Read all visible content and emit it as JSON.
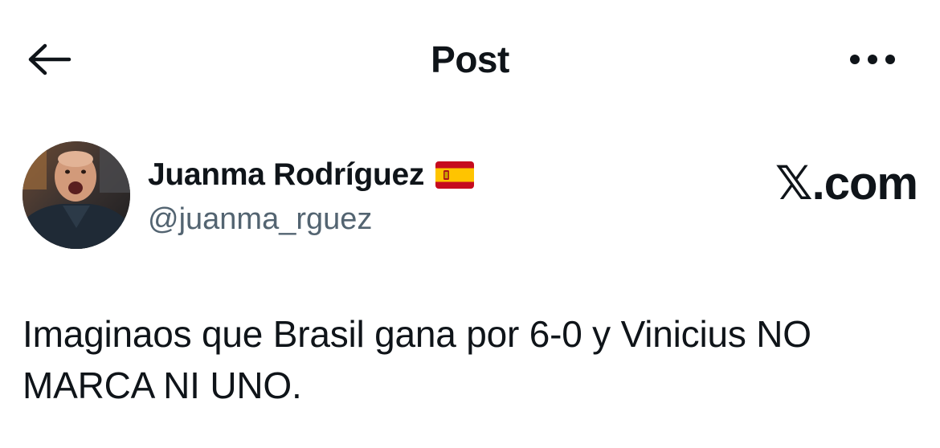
{
  "header": {
    "title": "Post",
    "back_icon": "arrow-left-icon",
    "more_icon": "more-horizontal-icon"
  },
  "author": {
    "display_name": "Juanma Rodríguez",
    "flag_icon": "spain-flag-icon",
    "handle": "@juanma_rguez",
    "avatar_icon": "avatar-photo"
  },
  "watermark": {
    "logo_letter": "𝕏",
    "suffix": ".com"
  },
  "tweet": {
    "text": "Imaginaos que Brasil gana por 6-0 y Vinicius NO MARCA NI UNO."
  },
  "colors": {
    "text_primary": "#0f1419",
    "text_secondary": "#536471",
    "background": "#ffffff"
  }
}
